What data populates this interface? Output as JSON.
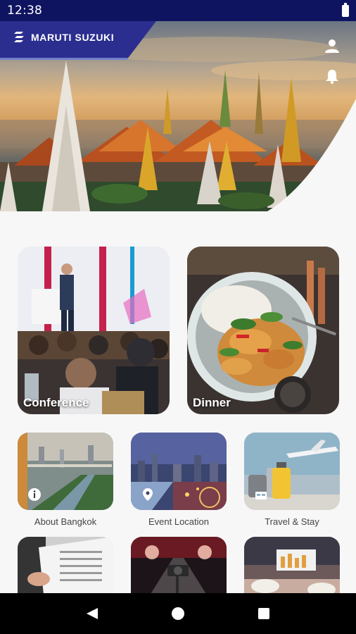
{
  "status_bar": {
    "time": "12:38",
    "battery_icon": "battery-full-icon"
  },
  "header": {
    "brand": "MARUTI SUZUKI",
    "brand_color": "#2b2e8f",
    "profile_icon": "user-icon",
    "notification_icon": "bell-icon"
  },
  "feature_tiles": [
    {
      "label": "Conference",
      "image": "conference-hall-photo"
    },
    {
      "label": "Dinner",
      "image": "thai-curry-dish-photo"
    }
  ],
  "menu_tiles": [
    {
      "label": "About Bangkok",
      "image": "bangkok-riverside-photo",
      "badge_icon": "info-icon"
    },
    {
      "label": "Event Location",
      "image": "bangkok-skyline-photo",
      "badge_icon": "location-pin-icon"
    },
    {
      "label": "Travel & Stay",
      "image": "luggage-airplane-photo",
      "badge_icon": "hotel-icon"
    },
    {
      "label": "",
      "image": "documents-photo"
    },
    {
      "label": "",
      "image": "stage-camera-photo"
    },
    {
      "label": "",
      "image": "meeting-room-photo"
    }
  ],
  "nav_bar": {
    "back_icon": "back-triangle-icon",
    "home_icon": "home-circle-icon",
    "recents_icon": "recents-square-icon"
  }
}
